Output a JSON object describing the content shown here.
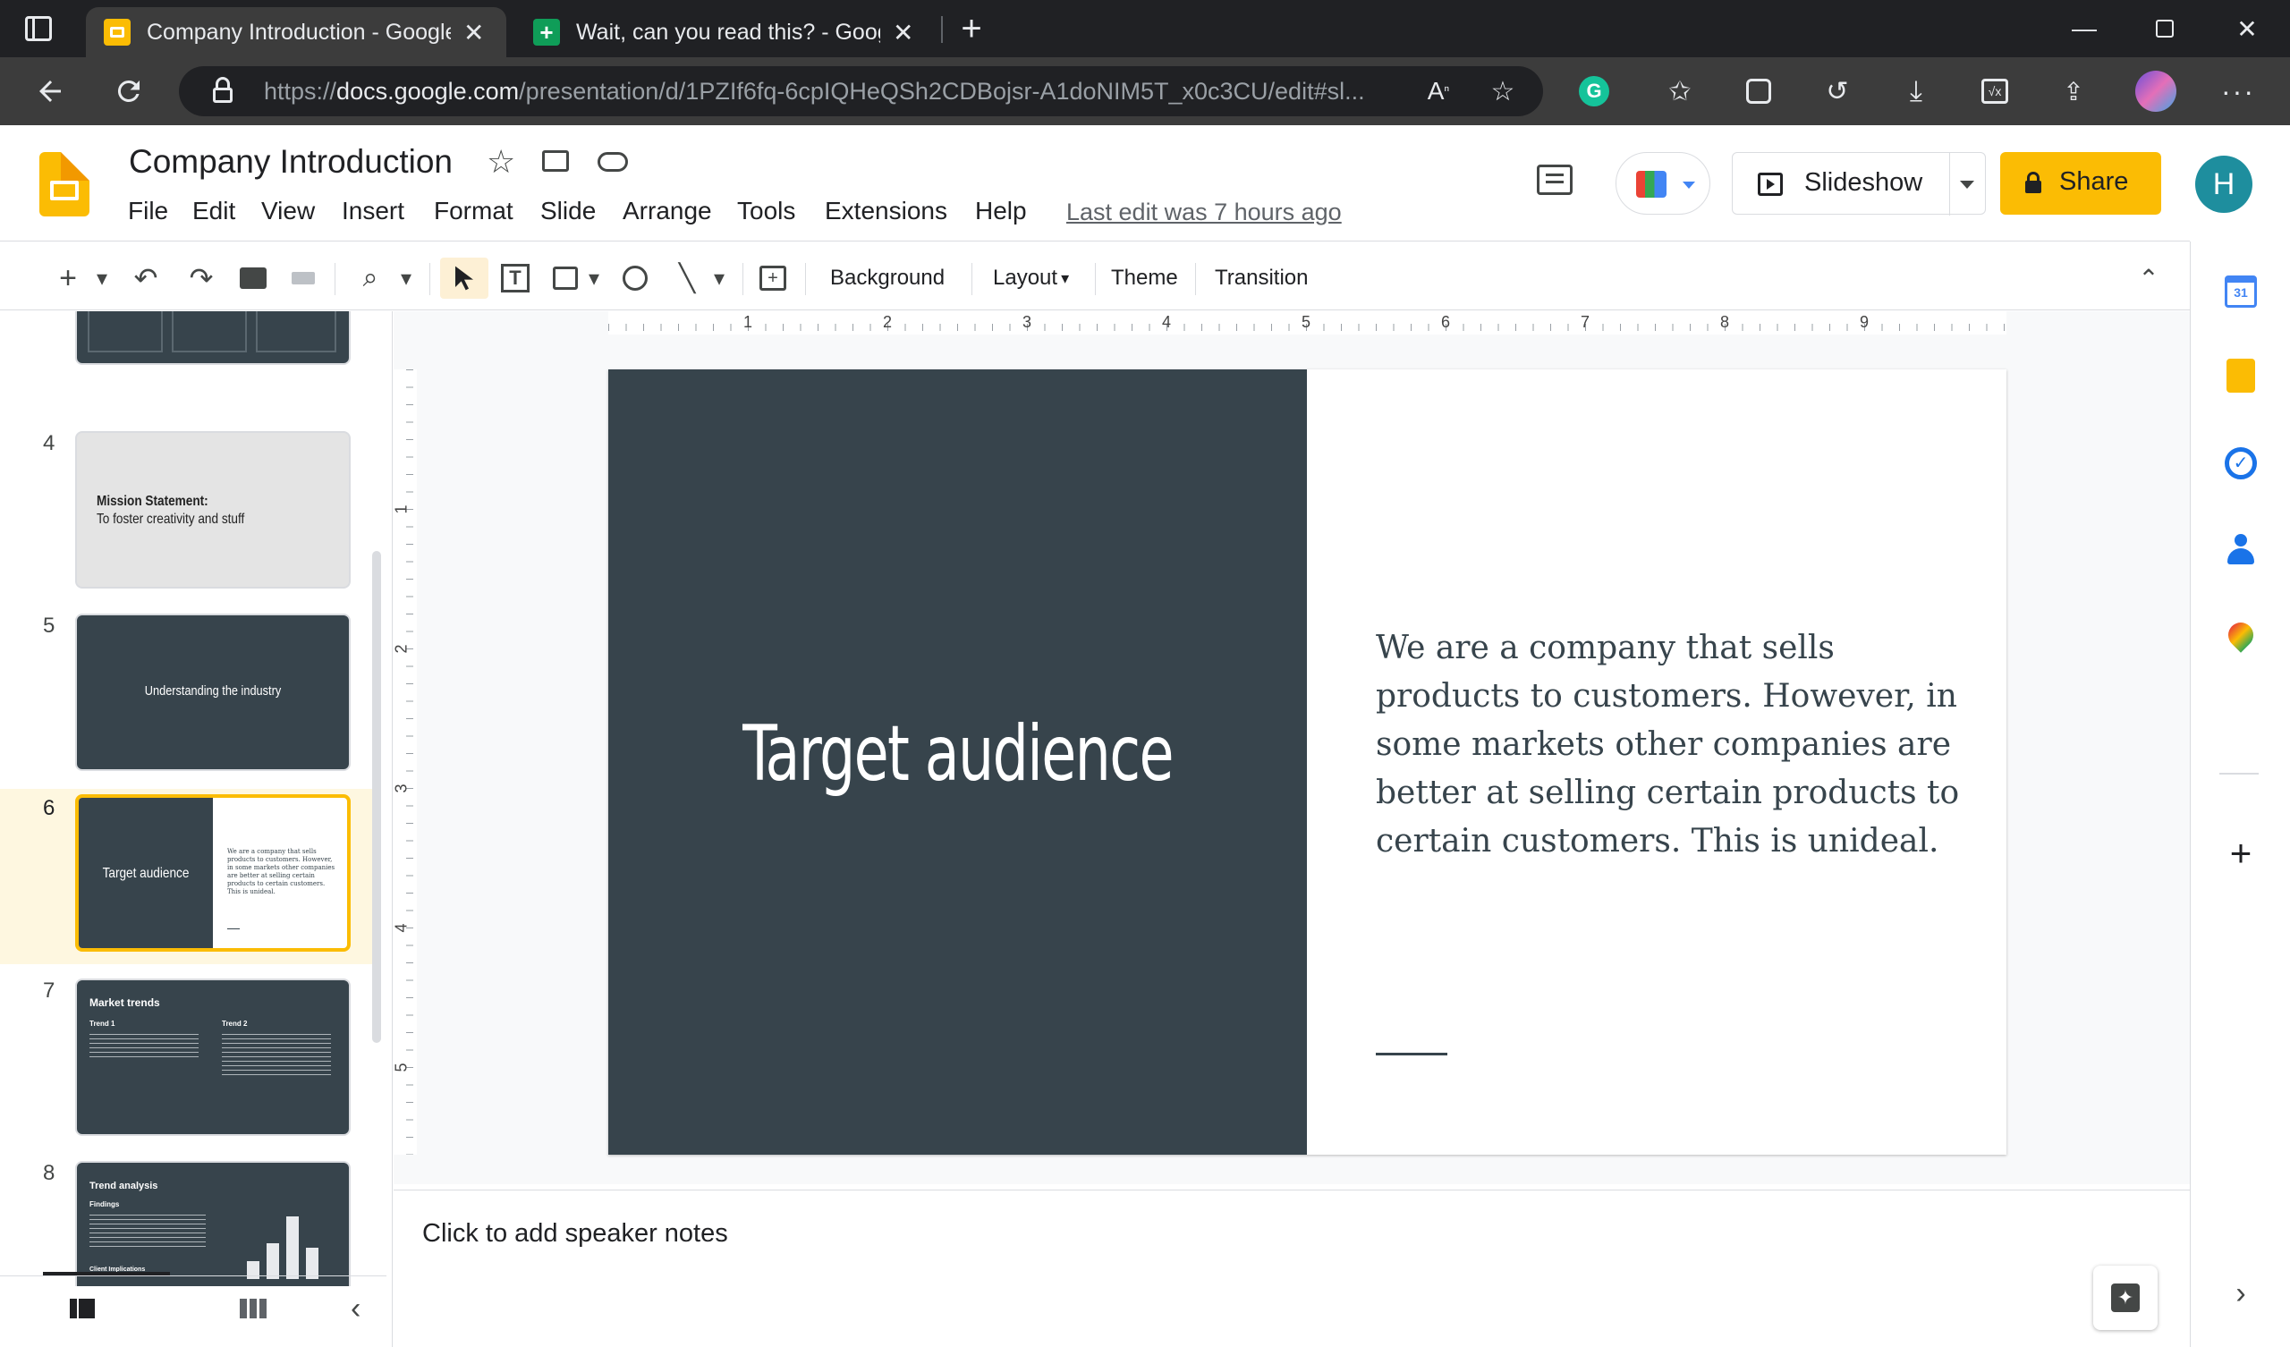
{
  "browser": {
    "tabs": [
      {
        "title": "Company Introduction - Google Slides",
        "active": true,
        "favicon_color": "#fbbc04"
      },
      {
        "title": "Wait, can you read this? - Google Sheets",
        "active": false,
        "favicon_color": "#0f9d58"
      }
    ],
    "url_prefix": "https://",
    "url_host": "docs.google.com",
    "url_path": "/presentation/d/1PZIf6fq-6cpIQHeQSh2CDBojsr-A1doNIM5T_x0c3CU/edit#sl..."
  },
  "doc": {
    "title": "Company Introduction",
    "menu": [
      "File",
      "Edit",
      "View",
      "Insert",
      "Format",
      "Slide",
      "Arrange",
      "Tools",
      "Extensions",
      "Help"
    ],
    "last_edit": "Last edit was 7 hours ago",
    "slideshow_label": "Slideshow",
    "share_label": "Share",
    "avatar_letter": "H",
    "brand_color": "#fbbc04",
    "share_color": "#fbbc04",
    "avatar_color": "#1e8e9e"
  },
  "toolbar": {
    "background": "Background",
    "layout": "Layout",
    "theme": "Theme",
    "transition": "Transition"
  },
  "filmstrip": {
    "slides": [
      {
        "num": "4",
        "title": "Mission Statement:",
        "subtitle": "To foster creativity and stuff"
      },
      {
        "num": "5",
        "title": "Understanding the industry"
      },
      {
        "num": "6",
        "title": "Target audience",
        "body": "We are a company that sells products to customers. However, in some markets other companies are better at selling certain products to certain customers. This is unideal."
      },
      {
        "num": "7",
        "title": "Market trends",
        "col1_head": "Trend 1",
        "col2_head": "Trend 2"
      },
      {
        "num": "8",
        "title": "Trend analysis",
        "subhead": "Findings",
        "subhead2": "Client Implications"
      }
    ]
  },
  "ruler": {
    "h_labels": [
      "1",
      "2",
      "3",
      "4",
      "5",
      "6",
      "7",
      "8",
      "9"
    ],
    "v_labels": [
      "1",
      "2",
      "3",
      "4",
      "5"
    ]
  },
  "slide": {
    "title": "Target audience",
    "body": "We are a company that sells products to customers. However, in some markets other companies are better at selling certain products to certain customers. This is unideal.",
    "dark_color": "#37444c"
  },
  "notes": {
    "placeholder": "Click to add speaker notes"
  },
  "sidepanel": {
    "calendar_label": "31"
  }
}
